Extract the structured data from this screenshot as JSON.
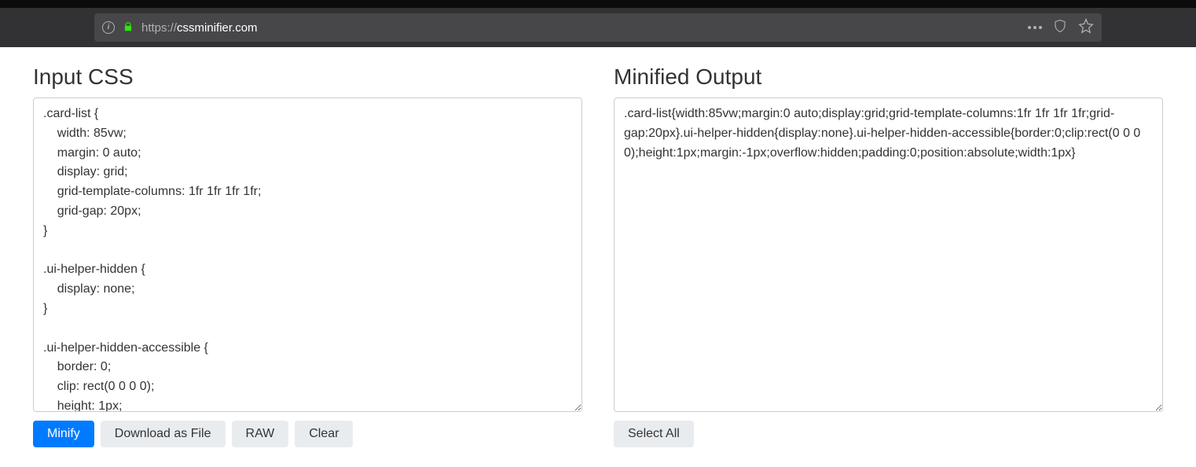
{
  "browser": {
    "url_prefix": "https://",
    "url_domain": "cssminifier.com"
  },
  "input": {
    "heading": "Input CSS",
    "value": ".card-list {\n    width: 85vw;\n    margin: 0 auto;\n    display: grid;\n    grid-template-columns: 1fr 1fr 1fr 1fr;\n    grid-gap: 20px;\n}\n\n.ui-helper-hidden {\n    display: none;\n}\n\n.ui-helper-hidden-accessible {\n    border: 0;\n    clip: rect(0 0 0 0);\n    height: 1px;"
  },
  "output": {
    "heading": "Minified Output",
    "value": ".card-list{width:85vw;margin:0 auto;display:grid;grid-template-columns:1fr 1fr 1fr 1fr;grid-gap:20px}.ui-helper-hidden{display:none}.ui-helper-hidden-accessible{border:0;clip:rect(0 0 0 0);height:1px;margin:-1px;overflow:hidden;padding:0;position:absolute;width:1px}"
  },
  "buttons": {
    "minify": "Minify",
    "download": "Download as File",
    "raw": "RAW",
    "clear": "Clear",
    "selectall": "Select All"
  }
}
